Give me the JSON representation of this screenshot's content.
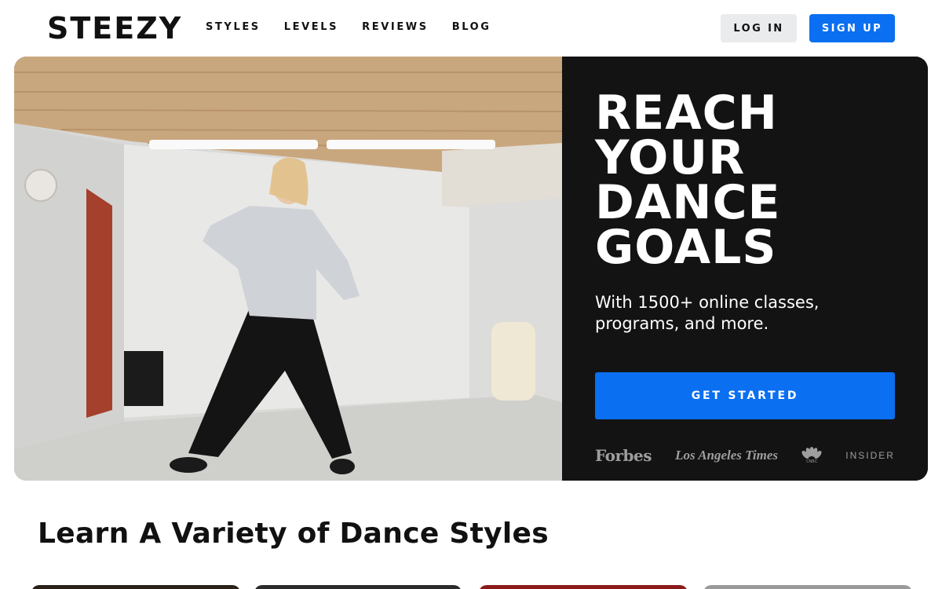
{
  "nav": {
    "logo": "STEEZY",
    "links": [
      "STYLES",
      "LEVELS",
      "REVIEWS",
      "BLOG"
    ],
    "login_label": "LOG IN",
    "signup_label": "SIGN UP"
  },
  "hero": {
    "headline": [
      "REACH",
      "YOUR",
      "DANCE",
      "GOALS"
    ],
    "subtext": "With 1500+ online classes, programs, and more.",
    "cta_label": "GET STARTED",
    "press": {
      "forbes": "Forbes",
      "la_times": "Los Angeles Times",
      "cnbc": "CNBC",
      "insider": "INSIDER"
    }
  },
  "section": {
    "title": "Learn A Variety of Dance Styles"
  },
  "colors": {
    "accent": "#0a6ff0",
    "hero_panel": "#131313",
    "login_bg": "#e9ebec"
  }
}
